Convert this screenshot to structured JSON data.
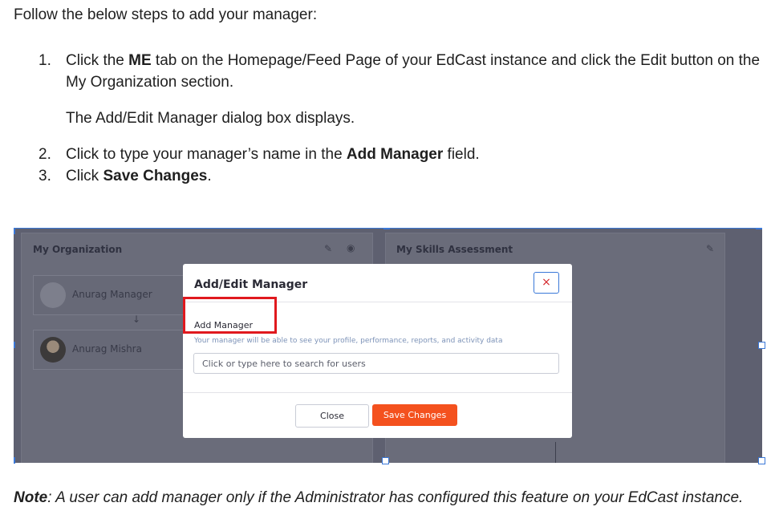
{
  "intro": "Follow the below steps to add your manager:",
  "steps": [
    {
      "num": "1.",
      "pre": "Click the ",
      "bold": "ME",
      "post": " tab on the Homepage/Feed Page of your EdCast instance and click the Edit button on the My Organization section."
    },
    {
      "sub": "The Add/Edit Manager dialog box displays."
    },
    {
      "num": "2.",
      "pre": "Click to type your manager’s name in the ",
      "bold": "Add Manager",
      "post": " field."
    },
    {
      "num": "3.",
      "pre": "Click ",
      "bold": "Save Changes",
      "post": "."
    }
  ],
  "screenshot": {
    "org_card": {
      "title": "My Organization",
      "manager_name": "Anurag Manager",
      "user_name": "Anurag Mishra"
    },
    "skills_card": {
      "title": "My Skills Assessment"
    },
    "dialog": {
      "title": "Add/Edit Manager",
      "close_icon": "×",
      "field_label": "Add Manager",
      "field_hint": "Your manager will be able to see your profile, performance, reports, and activity data",
      "search_placeholder": "Click or type here to search for users",
      "close_button": "Close",
      "save_button": "Save Changes"
    },
    "colors": {
      "overlay": "#5e6070",
      "save_button": "#f4511e",
      "highlight": "#e0191e"
    }
  },
  "note": {
    "label": "Note",
    "text": ": A user can add manager only if the Administrator has configured this feature on your EdCast instance."
  }
}
